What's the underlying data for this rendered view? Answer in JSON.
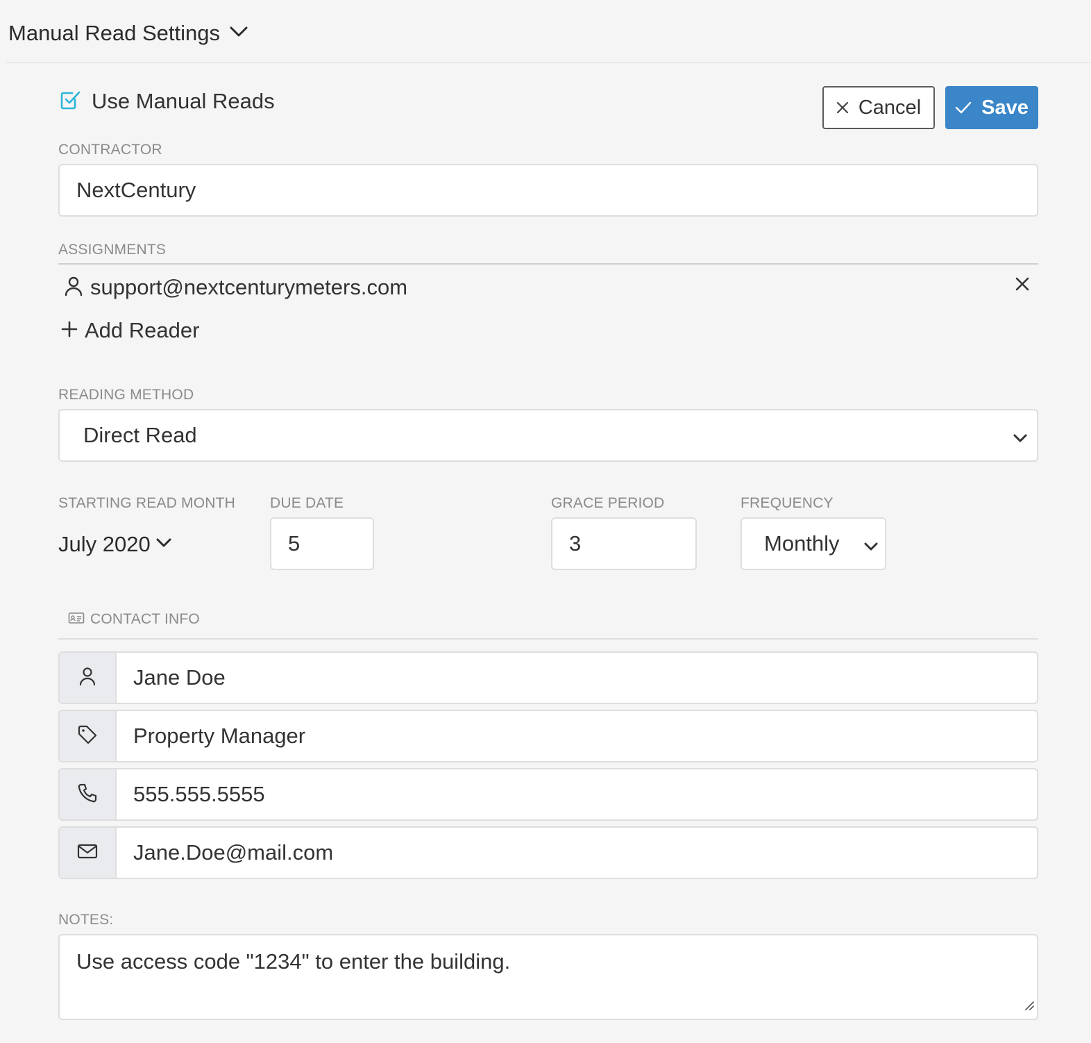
{
  "header": {
    "title": "Manual Read Settings",
    "toggle_icon": "chevron-down-icon"
  },
  "use_manual_reads": {
    "label": "Use Manual Reads",
    "checked": true,
    "accent_color": "#2bb5d8"
  },
  "actions": {
    "cancel_label": "Cancel",
    "save_label": "Save",
    "save_color": "#3a86c8"
  },
  "contractor": {
    "label": "CONTRACTOR",
    "value": "NextCentury"
  },
  "assignments": {
    "label": "ASSIGNMENTS",
    "items": [
      {
        "email": "support@nextcenturymeters.com",
        "icon": "user-icon"
      }
    ],
    "add_label": "Add Reader"
  },
  "reading_method": {
    "label": "READING METHOD",
    "selected": "Direct Read"
  },
  "schedule": {
    "start_month_label": "STARTING READ MONTH",
    "start_month_value": "July 2020",
    "due_date_label": "DUE DATE",
    "due_date_value": "5",
    "grace_period_label": "GRACE PERIOD",
    "grace_period_value": "3",
    "frequency_label": "FREQUENCY",
    "frequency_value": "Monthly"
  },
  "contact_info": {
    "label": "CONTACT INFO",
    "name": "Jane Doe",
    "title": "Property Manager",
    "phone": "555.555.5555",
    "email": "Jane.Doe@mail.com"
  },
  "notes": {
    "label": "NOTES:",
    "value": "Use access code \"1234\" to enter the building."
  }
}
